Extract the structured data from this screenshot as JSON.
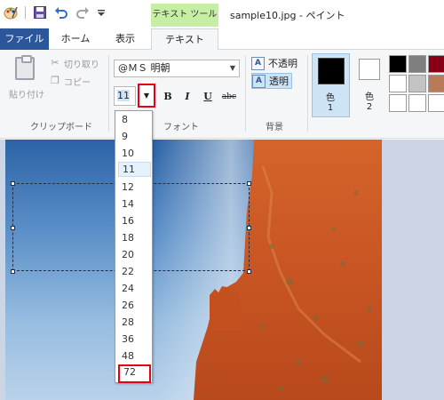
{
  "title_bar": {
    "window_title": "sample10.jpg - ペイント",
    "context_tab_label": "テキスト ツール"
  },
  "tabs": [
    {
      "label": "ファイル"
    },
    {
      "label": "ホーム"
    },
    {
      "label": "表示"
    },
    {
      "label": "テキスト"
    }
  ],
  "clipboard": {
    "paste": "貼り付け",
    "cut": "切り取り",
    "copy": "コピー",
    "group_label": "クリップボード"
  },
  "font": {
    "family": "@ＭＳ 明朝",
    "size": "11",
    "bold": "B",
    "italic": "I",
    "underline": "U",
    "strike": "abc",
    "group_label": "フォント"
  },
  "background": {
    "opaque": "不透明",
    "transparent": "透明",
    "group_label": "背景"
  },
  "colors": {
    "color1_label": "色",
    "color1_num": "1",
    "color2_label": "色",
    "color2_num": "2",
    "color1_value": "#000000",
    "color2_value": "#ffffff",
    "palette": [
      "#000000",
      "#7f7f7f",
      "#880015",
      "#ffffff",
      "#c3c3c3",
      "#b97a57",
      "#ffffff",
      "#ffffff",
      "#ffffff"
    ]
  },
  "size_list": [
    "8",
    "9",
    "10",
    "11",
    "12",
    "14",
    "16",
    "18",
    "20",
    "22",
    "24",
    "26",
    "28",
    "36",
    "48",
    "72"
  ],
  "size_selected": "11",
  "size_highlighted": "72",
  "accent": "#2b579a",
  "highlight_color": "#e60012"
}
